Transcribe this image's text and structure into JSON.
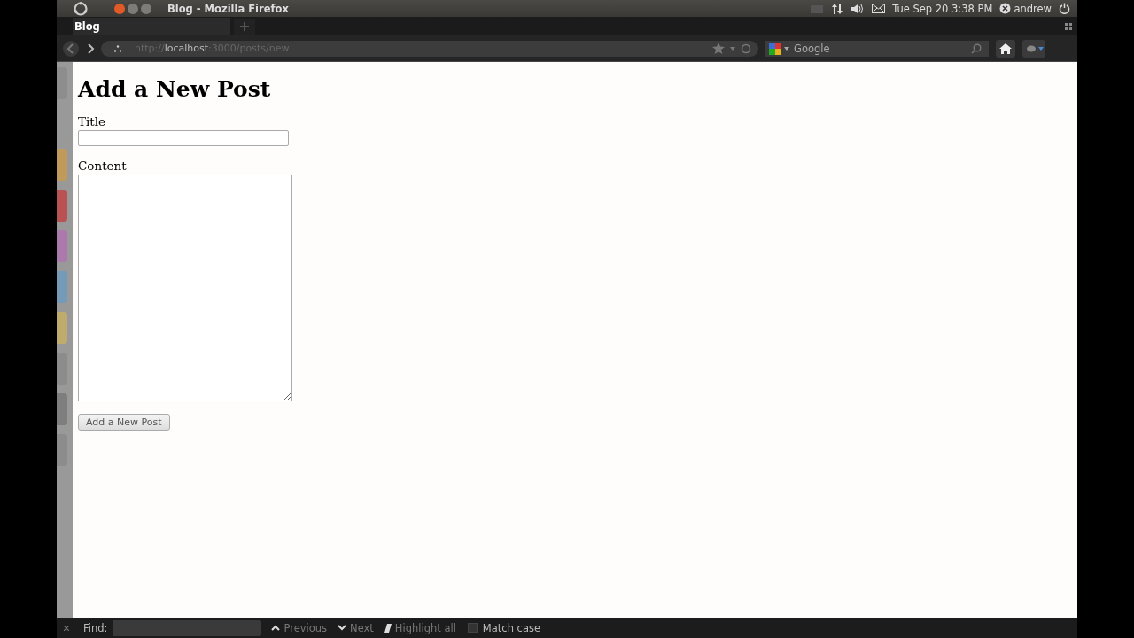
{
  "top_panel": {
    "window_title": "Blog - Mozilla Firefox",
    "clock": "Tue Sep 20  3:38 PM",
    "user": "andrew"
  },
  "tabs": [
    {
      "label": "Blog",
      "selected": true
    }
  ],
  "nav_bar": {
    "url_prefix": "http://",
    "url_host": "localhost",
    "url_rest": ":3000/posts/new",
    "search_placeholder": "Google"
  },
  "page": {
    "heading": "Add a New Post",
    "title_label": "Title",
    "content_label": "Content",
    "submit": "Add a New Post"
  },
  "find_bar": {
    "label": "Find:",
    "previous": "Previous",
    "next": "Next",
    "highlight_all": "Highlight all",
    "match_case": "Match case",
    "match_case_checked": false
  }
}
